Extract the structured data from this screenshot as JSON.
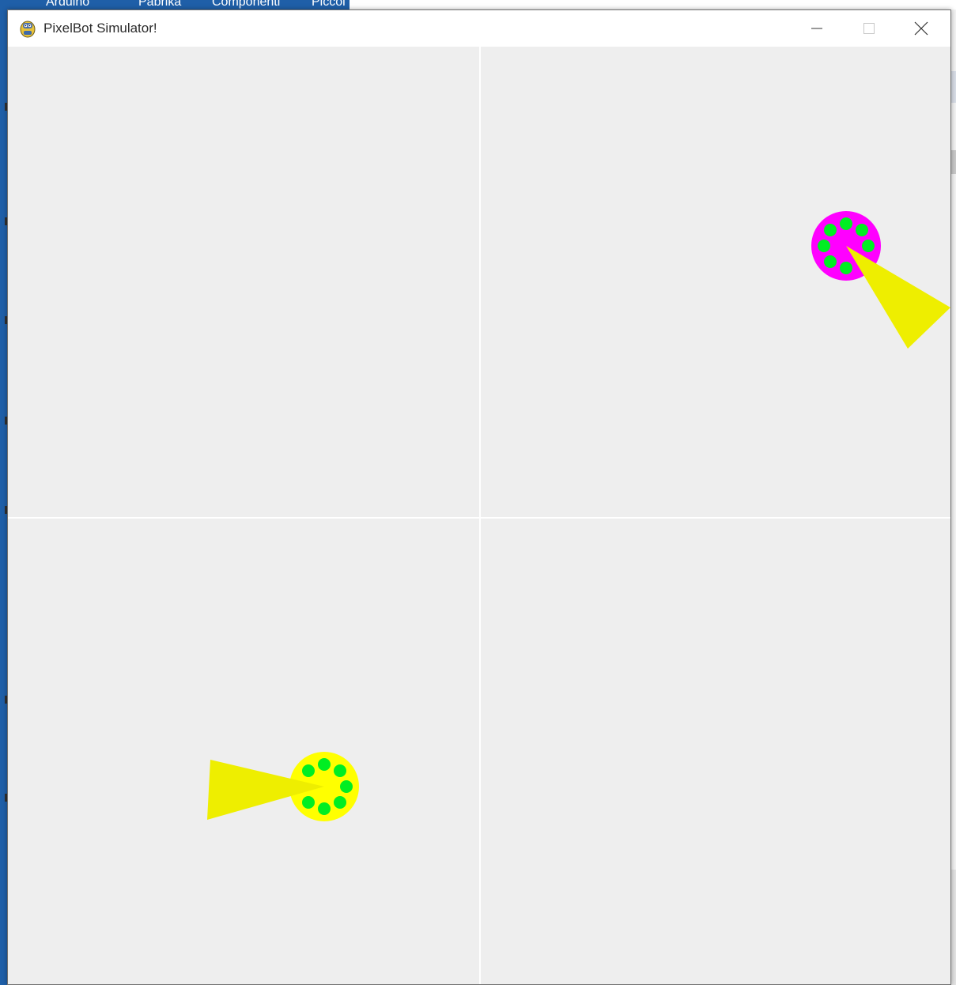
{
  "window": {
    "title": "PixelBot Simulator!",
    "controls": {
      "minimize_icon": "minimize-icon",
      "maximize_icon": "maximize-icon",
      "close_icon": "close-icon"
    }
  },
  "background_app": {
    "menu_items": [
      "Arduino",
      "Pabrika",
      "Componenti",
      "Piccol"
    ]
  },
  "simulation": {
    "background_color": "#eeeeee",
    "grid_line_color": "#ffffff",
    "quadrants": 4,
    "robots": [
      {
        "name": "robot-magenta",
        "body_color": "#ff00ff",
        "led_color": "#00ee22",
        "beam_color": "#eeee00",
        "led_count": 8,
        "heading": "down-right"
      },
      {
        "name": "robot-yellow",
        "body_color": "#ffff00",
        "led_color": "#00ee22",
        "beam_color": "#eeee00",
        "led_count": 8,
        "heading": "left"
      }
    ]
  }
}
